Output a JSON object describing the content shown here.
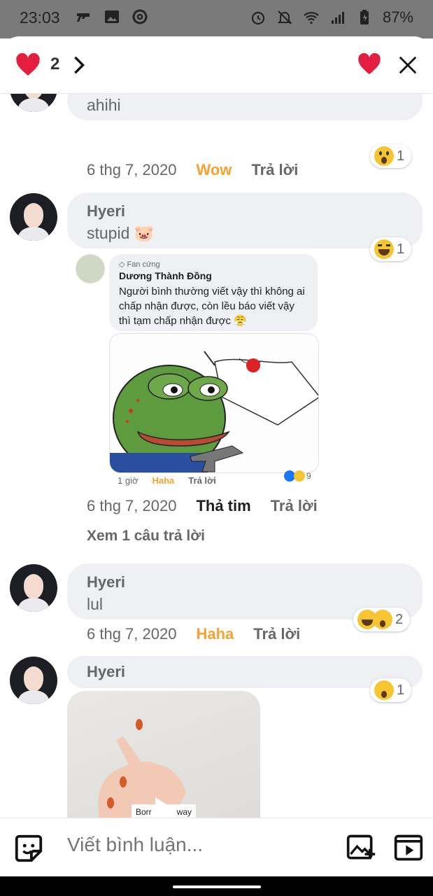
{
  "status": {
    "time": "23:03",
    "battery": "87%"
  },
  "top_bar": {
    "reaction_count": "2"
  },
  "comments": [
    {
      "author": "",
      "text": "ahihi",
      "date": "6 thg 7, 2020",
      "reaction": "Wow",
      "reply": "Trả lời",
      "pill_count": "1"
    },
    {
      "author": "Hyeri",
      "text": "stupid 🐷",
      "date": "6 thg 7, 2020",
      "reaction": "Thả tim",
      "reply": "Trả lời",
      "pill_count": "1",
      "view_replies": "Xem 1 câu trả lời"
    },
    {
      "author": "Hyeri",
      "text": "lul",
      "date": "6 thg 7, 2020",
      "reaction": "Haha",
      "reply": "Trả lời",
      "pill_count": "2"
    },
    {
      "author": "Hyeri",
      "pill_count": "1",
      "video_caption_left": "Borr",
      "video_caption_right": "way"
    }
  ],
  "shared_post": {
    "badge": "Fan cứng",
    "name": "Dương Thành Đồng",
    "text": "Người bình thường viết vậy thì không ai chấp nhận được, còn lều báo viết vậy thì tạm chấp nhận được 😤",
    "time": "1 giờ",
    "reaction": "Haha",
    "reply": "Trả lời",
    "reaction_count": "9"
  },
  "composer": {
    "placeholder": "Viết bình luận..."
  },
  "colors": {
    "accent_orange": "#f7a130",
    "heart_red": "#e41e3f",
    "bubble": "#eff0f4"
  }
}
